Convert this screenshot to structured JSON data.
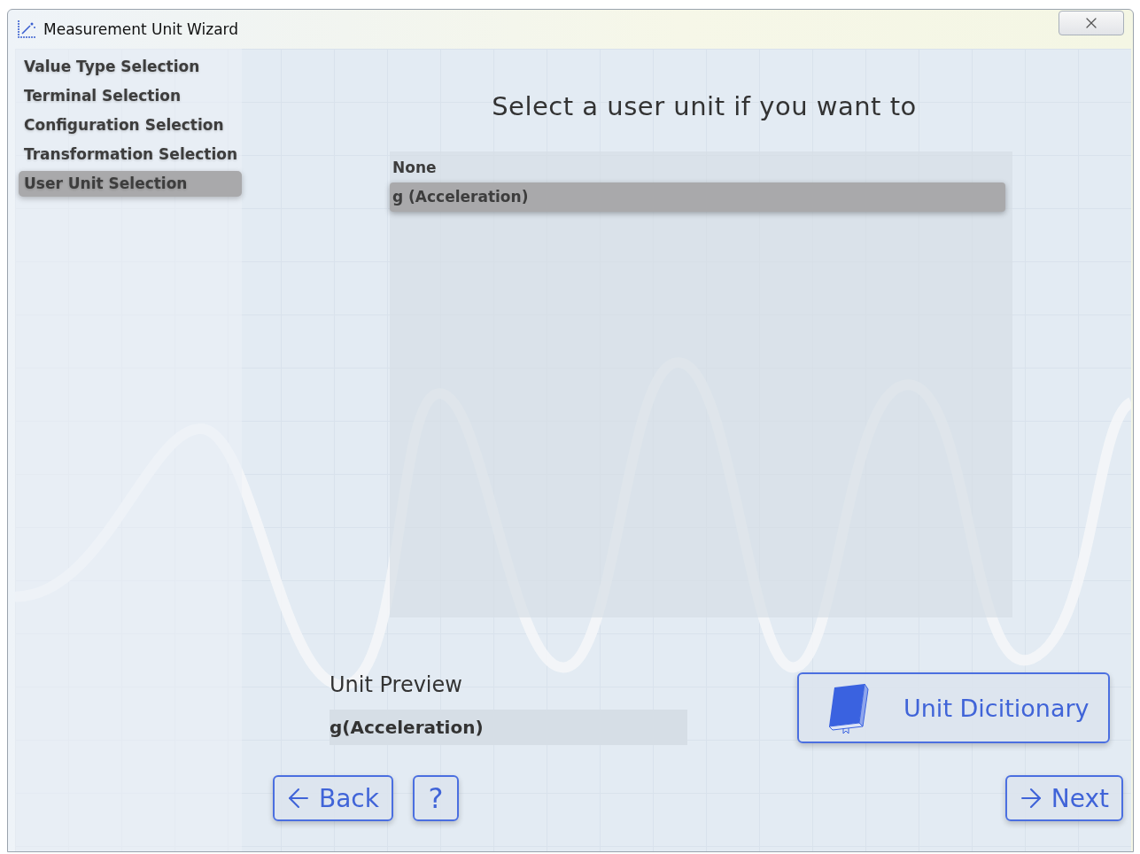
{
  "window": {
    "title": "Measurement Unit Wizard"
  },
  "steps": [
    {
      "label": "Value Type Selection",
      "selected": false
    },
    {
      "label": "Terminal Selection",
      "selected": false
    },
    {
      "label": "Configuration Selection",
      "selected": false
    },
    {
      "label": "Transformation Selection",
      "selected": false
    },
    {
      "label": "User Unit Selection",
      "selected": true
    }
  ],
  "heading": "Select a user unit if you want to",
  "units": [
    {
      "label": "None",
      "selected": false
    },
    {
      "label": "g (Acceleration)",
      "selected": true
    }
  ],
  "preview": {
    "label": "Unit Preview",
    "value": "g(Acceleration)"
  },
  "buttons": {
    "dictionary": "Unit Dicitionary",
    "back": "Back",
    "help": "?",
    "next": "Next"
  }
}
